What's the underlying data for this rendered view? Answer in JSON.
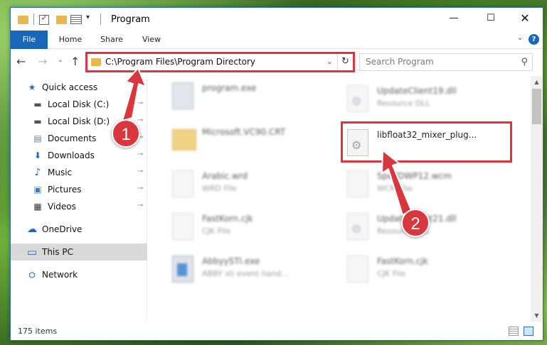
{
  "window": {
    "title": "Program",
    "controls": {
      "minimize": "—",
      "maximize": "☐",
      "close": "✕"
    }
  },
  "ribbon": {
    "tabs": [
      "File",
      "Home",
      "Share",
      "View"
    ],
    "expand_glyph": "⌄",
    "help_glyph": "?"
  },
  "navigation": {
    "back": "←",
    "forward": "→",
    "recent": "⌄",
    "up": "↑",
    "address": "C:\\Program Files\\Program Directory",
    "address_chevron": "⌄",
    "refresh": "↻",
    "search_placeholder": "Search Program",
    "search_glyph": "⚲"
  },
  "sidebar": {
    "items": [
      {
        "label": "Quick access",
        "icon": "star-icon",
        "glyph": "★",
        "color": "#2b6fb4"
      },
      {
        "label": "Local Disk (C:)",
        "icon": "drive-icon",
        "glyph": "▬",
        "color": "#555555"
      },
      {
        "label": "Local Disk (D:)",
        "icon": "drive-icon",
        "glyph": "▬",
        "color": "#555555"
      },
      {
        "label": "Documents",
        "icon": "documents-icon",
        "glyph": "▤",
        "color": "#6a7d92"
      },
      {
        "label": "Downloads",
        "icon": "download-icon",
        "glyph": "⬇",
        "color": "#1a67b8"
      },
      {
        "label": "Music",
        "icon": "music-icon",
        "glyph": "♪",
        "color": "#1a67b8"
      },
      {
        "label": "Pictures",
        "icon": "pictures-icon",
        "glyph": "▣",
        "color": "#3a7bbf"
      },
      {
        "label": "Videos",
        "icon": "videos-icon",
        "glyph": "▦",
        "color": "#333333"
      },
      {
        "label": "OneDrive",
        "icon": "cloud-icon",
        "glyph": "☁",
        "color": "#1a67b8"
      },
      {
        "label": "This PC",
        "icon": "computer-icon",
        "glyph": "▭",
        "color": "#2b6fb4"
      },
      {
        "label": "Network",
        "icon": "network-icon",
        "glyph": "⛭",
        "color": "#2b6fb4"
      }
    ],
    "pin_glyph": "📌"
  },
  "files": [
    {
      "name": "program.exe",
      "type": "",
      "icon": "exe"
    },
    {
      "name": "UpdateClient19.dll",
      "type": "Resource DLL",
      "icon": "dll"
    },
    {
      "name": "Microsoft.VC90.CRT",
      "type": "",
      "icon": "folder"
    },
    {
      "name": "libfloat32_mixer_plug...",
      "type": "",
      "icon": "dll"
    },
    {
      "name": "Arabic.wrd",
      "type": "WRD File",
      "icon": "doc"
    },
    {
      "name": "SpellDWP12.wcm",
      "type": "WCM File",
      "icon": "doc"
    },
    {
      "name": "FastKorn.cjk",
      "type": "CJK File",
      "icon": "doc"
    },
    {
      "name": "UpdateClient21.dll",
      "type": "Resource DLL",
      "icon": "dll"
    },
    {
      "name": "AbbyySTI.exe",
      "type": "ABBY sti event hand...",
      "icon": "abby"
    },
    {
      "name": "FastKorn.cjk",
      "type": "CJK File",
      "icon": "doc"
    }
  ],
  "status": {
    "items_count": "175 items"
  },
  "callouts": {
    "step1": "1",
    "step2": "2",
    "color": "#d9363e"
  }
}
